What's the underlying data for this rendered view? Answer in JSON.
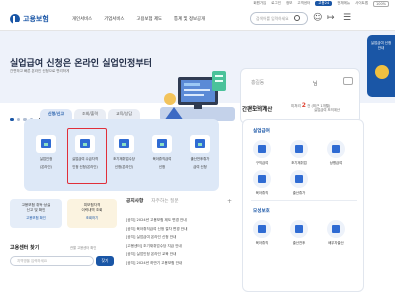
{
  "util": [
    "회원가입",
    "로그인",
    "정보",
    "고객센터",
    "고용24",
    "전체메뉴",
    "사이트맵",
    "100%"
  ],
  "header": {
    "logo": "고용보험",
    "nav": [
      "개인서비스",
      "기업서비스",
      "고용보험 제도",
      "통계 및 정보공개"
    ],
    "search_placeholder": "검색어를 입력하세요"
  },
  "hero": {
    "title": "실업급여 신청은 온라인 실업인정부터",
    "subtitle": "간편하고 빠른 온라인 신청으로 편리하게"
  },
  "user": {
    "name": "홍길동",
    "honorific": "님",
    "blocked": "이용 차단됨",
    "count_prefix": "미처리",
    "count": "2",
    "count_suffix": "건 (최근 1개월)"
  },
  "side_banner": "실업급여 신청안내",
  "service_tabs": [
    "신청/신고",
    "조회/출력",
    "교육/상담"
  ],
  "services": [
    {
      "label1": "실업인정",
      "label2": "(온라인)"
    },
    {
      "label1": "실업급여 수급자격",
      "label2": "인정 신청(온라인)"
    },
    {
      "label1": "조기재취업수당",
      "label2": "신청(온라인)"
    },
    {
      "label1": "육아휴직급여",
      "label2": "신청"
    },
    {
      "label1": "출산전후휴가",
      "label2": "급여 신청"
    }
  ],
  "cards": [
    {
      "title1": "고용보험 취득·상실",
      "title2": "신고 및 확인",
      "link": "고용보험 확인"
    },
    {
      "title1": "피보험자격",
      "title2": "이력내역 조회",
      "link": "조회하기"
    }
  ],
  "notice": {
    "tabs": [
      "공지사항",
      "자주하는 질문"
    ],
    "more": "+",
    "items": [
      "[공지] 2024년 고용보험 제도 변경 안내",
      "[공지] 육아휴직급여 신청 절차 변경 안내",
      "[공지] 실업급여 온라인 신청 안내",
      "[고용센터] 조기재취업수당 지급 안내",
      "[공지] 실업인정 온라인 교육 안내",
      "[공지] 2024년 하반기 고용보험 안내"
    ]
  },
  "center": {
    "title": "고용센터 찾기",
    "sub": "관할 고용센터 확인",
    "placeholder": "지역명을 입력하세요",
    "button": "찾기"
  },
  "calc": {
    "title": "간편모의계산",
    "more": "실업급여 모의계산",
    "section1": "실업급여",
    "items1": [
      "구직급여",
      "조기재취업",
      "상병급여",
      "육아휴직",
      "출산휴가"
    ],
    "section2": "모성보호",
    "items2": [
      "육아휴직",
      "출산전후",
      "배우자출산"
    ]
  }
}
